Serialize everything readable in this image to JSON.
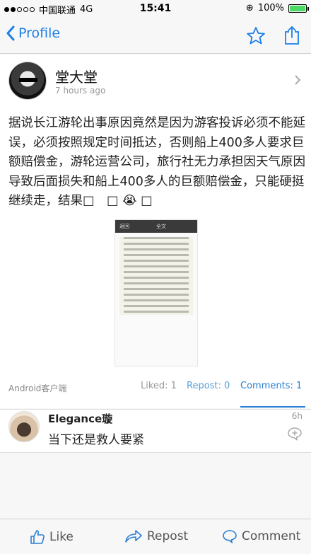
{
  "status_bar": {
    "carrier": "中国联通",
    "network": "4G",
    "time": "15:41",
    "battery": "100%",
    "battery_level": 1.0
  },
  "nav": {
    "back_label": "Profile",
    "accent_color": "#1a7fe8",
    "icons": [
      "star-icon",
      "share-icon"
    ]
  },
  "post": {
    "username": "堂大堂",
    "time": "7 hours ago",
    "text": "据说长江游轮出事原因竟然是因为游客投诉必须不能延误，必须按照规定时间抵达，否则船上400多人要求巨额赔偿金，游轮运营公司，旅行社无力承担因天气原因导致后面损失和船上400多人的巨额赔偿金，只能硬挺继续走，结果□　□ 😭 □",
    "source": "Android客户端",
    "liked": "Liked: 1",
    "repost": "Repost: 0",
    "comments": "Comments: 1"
  },
  "thumbnail": {
    "back_text": "返回",
    "title": "全文"
  },
  "comment": {
    "name": "Elegance璇",
    "time": "6h",
    "text": "当下还是救人要紧"
  },
  "bottom_bar": {
    "like": "Like",
    "repost": "Repost",
    "comment": "Comment"
  }
}
